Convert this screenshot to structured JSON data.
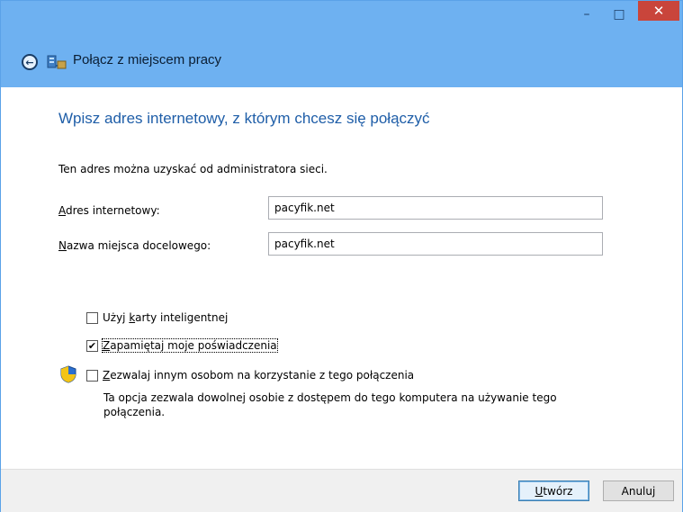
{
  "window": {
    "title": "Połącz z miejscem pracy",
    "controls": {
      "minimize": "–",
      "maximize": "□",
      "close": "✕"
    },
    "icons": {
      "back": "arrow-left-icon",
      "network": "network-places-icon"
    }
  },
  "content": {
    "heading": "Wpisz adres internetowy, z którym chcesz się połączyć",
    "description": "Ten adres można uzyskać od administratora sieci.",
    "url_label_accel": "A",
    "url_label_rest": "dres internetowy:",
    "url_value": "pacyfik.net",
    "name_label_accel": "N",
    "name_label_rest": "azwa miejsca docelowego:",
    "name_value": "pacyfik.net"
  },
  "options": {
    "smart_card": {
      "pre": "Użyj ",
      "accel": "k",
      "post": "arty inteligentnej",
      "checked": false
    },
    "remember": {
      "pre": "",
      "accel": "Z",
      "post": "apamiętaj moje poświadczenia",
      "checked": true
    },
    "allow_others": {
      "pre": "",
      "accel": "Z",
      "post": "ezwalaj innym osobom na korzystanie z tego połączenia",
      "checked": false,
      "description": "Ta opcja zezwala dowolnej osobie z dostępem do tego komputera na używanie tego połączenia."
    }
  },
  "footer": {
    "create_accel": "U",
    "create_rest": "twórz",
    "cancel": "Anuluj"
  },
  "colors": {
    "titlebar": "#6eb1f1",
    "close": "#c9453b",
    "heading": "#1f5ea8"
  }
}
